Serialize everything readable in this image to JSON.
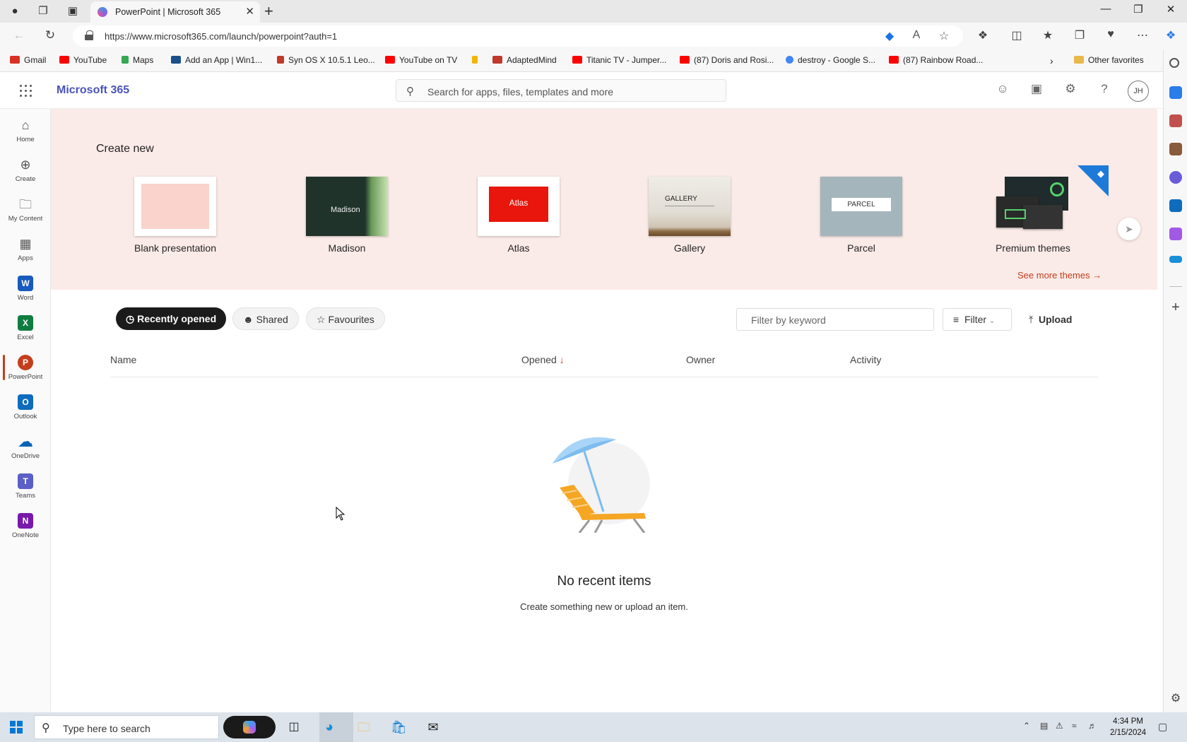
{
  "browser": {
    "tab_title": "PowerPoint | Microsoft 365",
    "url": "https://www.microsoft365.com/launch/powerpoint?auth=1",
    "favorites": [
      {
        "label": "Gmail",
        "color": "#d93025"
      },
      {
        "label": "YouTube",
        "color": "#ff0000"
      },
      {
        "label": "Maps",
        "color": "#34a853"
      },
      {
        "label": "Add an App | Win1...",
        "color": "#1a4f8a"
      },
      {
        "label": "Syn OS X 10.5.1 Leo...",
        "color": "#c0392b"
      },
      {
        "label": "YouTube on TV",
        "color": "#ff0000"
      },
      {
        "label": "",
        "color": "#f5b400"
      },
      {
        "label": "AdaptedMind",
        "color": "#c0392b"
      },
      {
        "label": "Titanic TV - Jumper...",
        "color": "#ff0000"
      },
      {
        "label": "(87) Doris and Rosi...",
        "color": "#ff0000"
      },
      {
        "label": "destroy - Google S...",
        "color": "#4285f4"
      },
      {
        "label": "(87) Rainbow Road...",
        "color": "#ff0000"
      }
    ],
    "other_favorites": "Other favorites"
  },
  "header": {
    "app_name": "Microsoft 365",
    "search_placeholder": "Search for apps, files, templates and more",
    "avatar_initials": "JH"
  },
  "rail": [
    {
      "label": "Home",
      "icon": "home-icon"
    },
    {
      "label": "Create",
      "icon": "create-icon"
    },
    {
      "label": "My Content",
      "icon": "folder-icon"
    },
    {
      "label": "Apps",
      "icon": "apps-icon"
    },
    {
      "label": "Word",
      "icon": "word-icon",
      "color": "#185abd",
      "letter": "W"
    },
    {
      "label": "Excel",
      "icon": "excel-icon",
      "color": "#107c41",
      "letter": "X"
    },
    {
      "label": "PowerPoint",
      "icon": "powerpoint-icon",
      "color": "#c43e1c",
      "letter": "P"
    },
    {
      "label": "Outlook",
      "icon": "outlook-icon",
      "color": "#0f6cbd",
      "letter": "O"
    },
    {
      "label": "OneDrive",
      "icon": "onedrive-icon",
      "color": "#0364b8",
      "letter": ""
    },
    {
      "label": "Teams",
      "icon": "teams-icon",
      "color": "#5b5fc7",
      "letter": "T"
    },
    {
      "label": "OneNote",
      "icon": "onenote-icon",
      "color": "#7719aa",
      "letter": "N"
    }
  ],
  "create": {
    "title": "Create new",
    "templates": [
      {
        "label": "Blank presentation",
        "thumb_text": ""
      },
      {
        "label": "Madison",
        "thumb_text": "Madison"
      },
      {
        "label": "Atlas",
        "thumb_text": "Atlas"
      },
      {
        "label": "Gallery",
        "thumb_text": "GALLERY"
      },
      {
        "label": "Parcel",
        "thumb_text": "PARCEL"
      },
      {
        "label": "Premium themes",
        "thumb_text": ""
      }
    ],
    "see_more": "See more themes"
  },
  "files": {
    "tabs": [
      "Recently opened",
      "Shared",
      "Favourites"
    ],
    "filter_placeholder": "Filter by keyword",
    "filter_label": "Filter",
    "upload_label": "Upload",
    "columns": [
      "Name",
      "Opened",
      "Owner",
      "Activity"
    ],
    "empty_title": "No recent items",
    "empty_subtitle": "Create something new or upload an item."
  },
  "taskbar": {
    "search_placeholder": "Type here to search",
    "time": "4:34 PM",
    "date": "2/15/2024"
  },
  "colors": {
    "accent": "#c43e1c",
    "brand": "#4b53bc",
    "hero_bg": "#fbebe8"
  }
}
